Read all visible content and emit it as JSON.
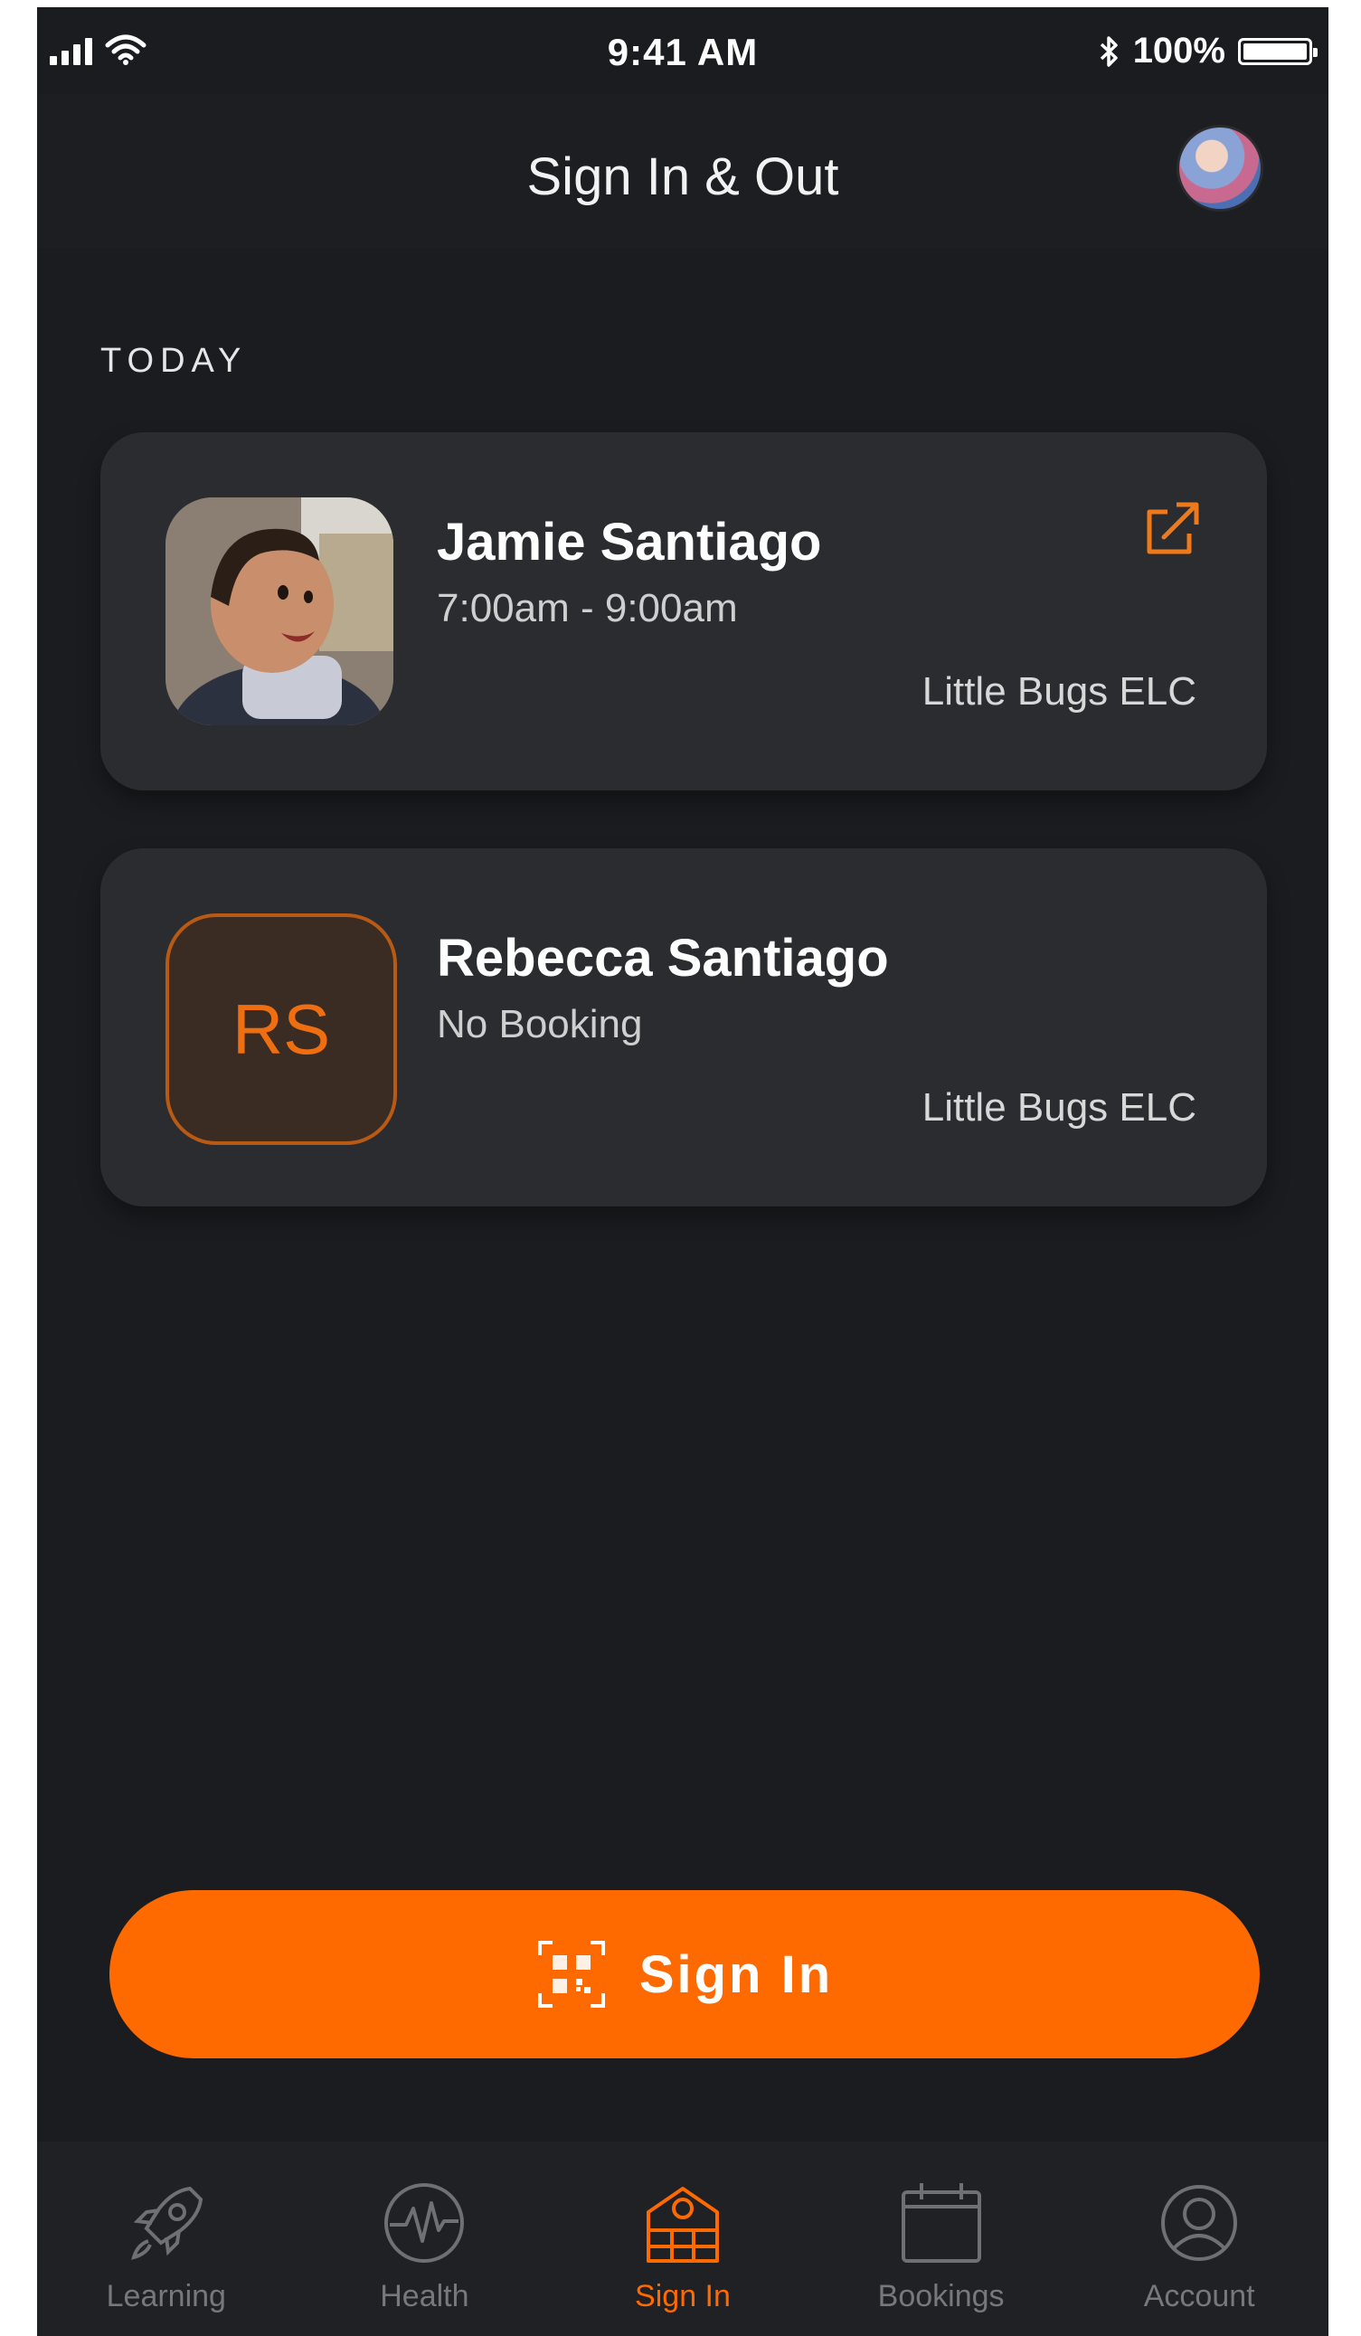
{
  "status_bar": {
    "time": "9:41 AM",
    "battery_percent": "100%",
    "battery_level": 1.0
  },
  "header": {
    "title": "Sign In & Out"
  },
  "section": {
    "label": "TODAY"
  },
  "children": [
    {
      "name": "Jamie Santiago",
      "booking": "7:00am - 9:00am",
      "centre": "Little Bugs ELC"
    },
    {
      "initials": "RS",
      "name": "Rebecca Santiago",
      "booking": "No Booking",
      "centre": "Little Bugs ELC"
    }
  ],
  "sign_in_button": {
    "label": "Sign In"
  },
  "tabs": [
    {
      "label": "Learning",
      "icon": "rocket-icon"
    },
    {
      "label": "Health",
      "icon": "heartbeat-icon"
    },
    {
      "label": "Sign In",
      "icon": "building-icon"
    },
    {
      "label": "Bookings",
      "icon": "calendar-icon"
    },
    {
      "label": "Account",
      "icon": "user-icon"
    }
  ],
  "colors": {
    "accent": "#ff6a00",
    "background": "#1b1c1f",
    "card": "#2b2c30"
  }
}
